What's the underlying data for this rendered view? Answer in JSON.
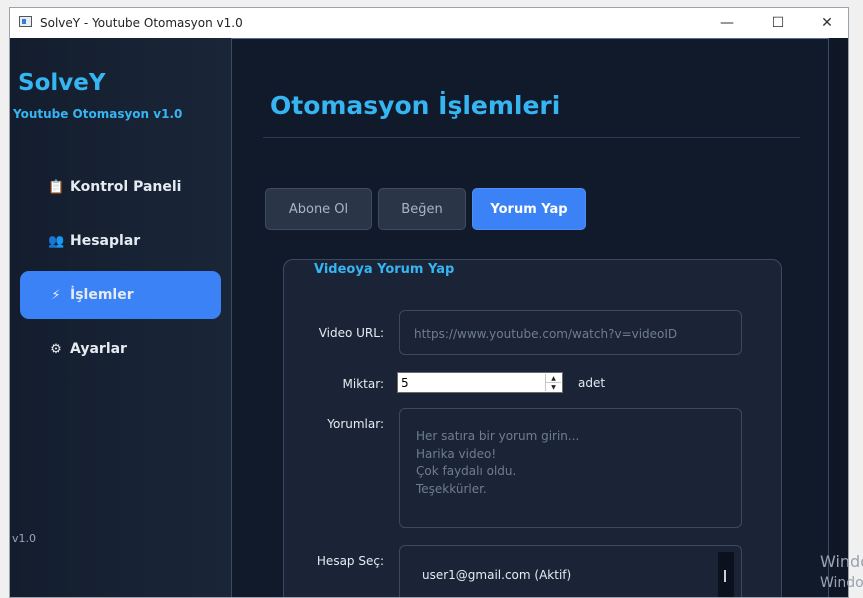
{
  "window": {
    "title": "SolveY - Youtube Otomasyon v1.0"
  },
  "sidebar": {
    "brand": "SolveY",
    "subtitle": "Youtube Otomasyon v1.0",
    "items": [
      {
        "label": "Kontrol Paneli",
        "icon": "📋"
      },
      {
        "label": "Hesaplar",
        "icon": "👥"
      },
      {
        "label": "İşlemler",
        "icon": "⚡"
      },
      {
        "label": "Ayarlar",
        "icon": "⚙"
      }
    ],
    "version": "v1.0"
  },
  "main": {
    "title": "Otomasyon İşlemleri",
    "tabs": [
      "Abone Ol",
      "Beğen",
      "Yorum Yap"
    ],
    "active_tab": "Yorum Yap",
    "group": {
      "title": "Videoya Yorum Yap",
      "url_label": "Video URL:",
      "url_placeholder": "https://www.youtube.com/watch?v=videoID",
      "amount_label": "Miktar:",
      "amount_value": "5",
      "amount_unit": "adet",
      "comments_label": "Yorumlar:",
      "comments_placeholder": [
        "Her satıra bir yorum girin...",
        "Harika video!",
        "Çok faydalı oldu.",
        "Teşekkürler."
      ],
      "account_label": "Hesap Seç:",
      "accounts": [
        "user1@gmail.com (Aktif)"
      ]
    }
  },
  "overlay": {
    "watermark_line1": "Windo",
    "watermark_line2": "Windo"
  },
  "colors": {
    "accent": "#3b82f6",
    "title": "#36b5f2",
    "background": "#111a2b"
  }
}
